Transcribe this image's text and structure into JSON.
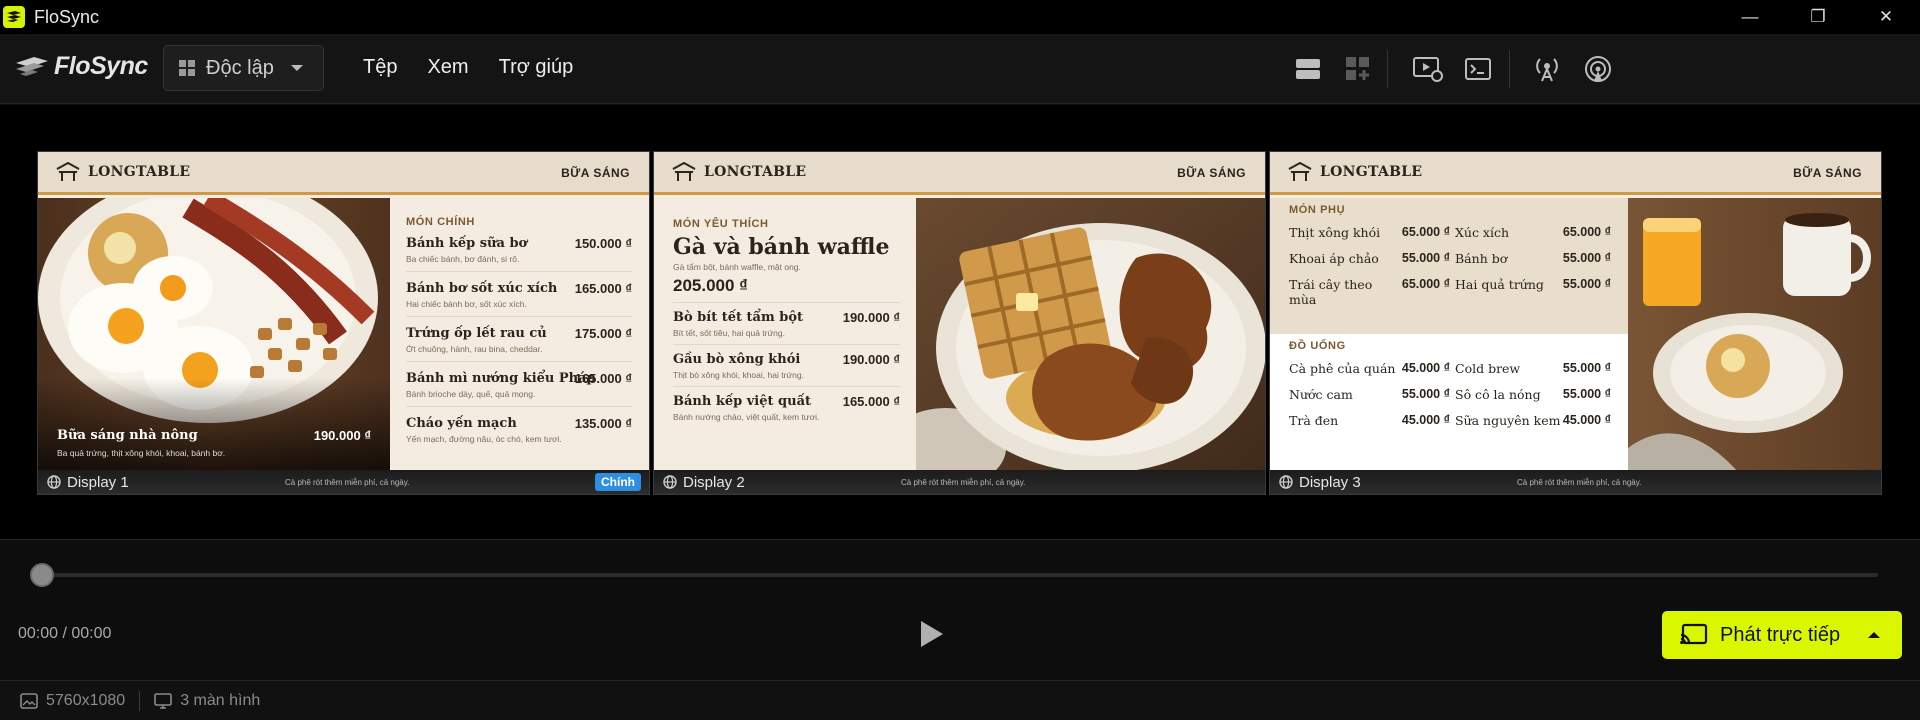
{
  "app": {
    "title": "FloSync",
    "logo_text": "FloSync"
  },
  "window_controls": {
    "minimize": "—",
    "restore": "❐",
    "close": "✕"
  },
  "toolbar": {
    "mode_label": "Độc lập",
    "menu": [
      "Tệp",
      "Xem",
      "Trợ giúp"
    ],
    "icons": [
      "layout-rows-icon",
      "add-widget-icon",
      "display-settings-icon",
      "terminal-icon",
      "broadcast-icon",
      "airplay-icon"
    ]
  },
  "displays": [
    {
      "label": "Display 1",
      "badge": "Chính",
      "brand": "LONGTABLE",
      "meal": "BỮA SÁNG",
      "footer_note": "Cà phê rót thêm miễn phí, cả ngày.",
      "photo_caption": {
        "name": "Bữa sáng nhà nông",
        "price": "190.000 ₫",
        "desc": "Ba quả trứng, thịt xông khói, khoai, bánh bơ."
      },
      "section": "MÓN CHÍNH",
      "items": [
        {
          "name": "Bánh kếp sữa bơ",
          "price": "150.000 ₫",
          "desc": "Ba chiếc bánh, bơ đánh, si rô."
        },
        {
          "name": "Bánh bơ sốt xúc xích",
          "price": "165.000 ₫",
          "desc": "Hai chiếc bánh bơ, sốt xúc xích."
        },
        {
          "name": "Trứng ốp lết rau củ",
          "price": "175.000 ₫",
          "desc": "Ớt chuông, hành, rau bina, cheddar."
        },
        {
          "name": "Bánh mì nướng kiểu Pháp",
          "price": "165.000 ₫",
          "desc": "Bánh brioche dày, quế, quả mọng."
        },
        {
          "name": "Cháo yến mạch",
          "price": "135.000 ₫",
          "desc": "Yến mạch, đường nâu, óc chó, kem tươi."
        }
      ]
    },
    {
      "label": "Display 2",
      "brand": "LONGTABLE",
      "meal": "BỮA SÁNG",
      "footer_note": "Cà phê rót thêm miễn phí, cả ngày.",
      "section": "MÓN YÊU THÍCH",
      "feature": {
        "name": "Gà và bánh waffle",
        "desc": "Gà tẩm bột, bánh waffle, mật ong.",
        "price": "205.000 ₫"
      },
      "items": [
        {
          "name": "Bò bít tết tẩm bột",
          "price": "190.000 ₫",
          "desc": "Bít tết, sốt tiêu, hai quả trứng."
        },
        {
          "name": "Gầu bò xông khói",
          "price": "190.000 ₫",
          "desc": "Thịt bò xông khói, khoai, hai trứng."
        },
        {
          "name": "Bánh kếp việt quất",
          "price": "165.000 ₫",
          "desc": "Bánh nướng chảo, việt quất, kem tươi."
        }
      ]
    },
    {
      "label": "Display 3",
      "brand": "LONGTABLE",
      "meal": "BỮA SÁNG",
      "footer_note": "Cà phê rót thêm miễn phí, cả ngày.",
      "sides_title": "MÓN PHỤ",
      "sides": [
        {
          "name": "Thịt xông khói",
          "price": "65.000 ₫"
        },
        {
          "name": "Xúc xích",
          "price": "65.000 ₫"
        },
        {
          "name": "Khoai áp chảo",
          "price": "55.000 ₫"
        },
        {
          "name": "Bánh bơ",
          "price": "55.000 ₫"
        },
        {
          "name": "Trái cây theo mùa",
          "price": "65.000 ₫"
        },
        {
          "name": "Hai quả trứng",
          "price": "55.000 ₫"
        }
      ],
      "drinks_title": "ĐỒ UỐNG",
      "drinks": [
        {
          "name": "Cà phê của quán",
          "price": "45.000 ₫"
        },
        {
          "name": "Cold brew",
          "price": "55.000 ₫"
        },
        {
          "name": "Nước cam",
          "price": "55.000 ₫"
        },
        {
          "name": "Sô cô la nóng",
          "price": "55.000 ₫"
        },
        {
          "name": "Trà đen",
          "price": "45.000 ₫"
        },
        {
          "name": "Sữa nguyên kem",
          "price": "45.000 ₫"
        }
      ]
    }
  ],
  "player": {
    "time": "00:00 / 00:00",
    "progress": 0
  },
  "stream_button": {
    "label": "Phát trực tiếp"
  },
  "status": {
    "resolution": "5760x1080",
    "screens": "3 màn hình"
  },
  "colors": {
    "accent": "#dbf700",
    "badge": "#2e8fe0",
    "menu_bg": "#f4ece0",
    "gold": "#cf9a45"
  }
}
